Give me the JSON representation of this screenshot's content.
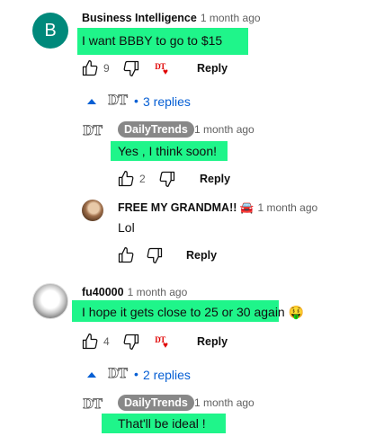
{
  "comments": [
    {
      "avatar_letter": "B",
      "author": "Business Intelligence",
      "time": "1 month ago",
      "text": "I want BBBY to go to $15",
      "likes": "9",
      "reply_label": "Reply",
      "replies_label": "3 replies",
      "replies": [
        {
          "author": "DailyTrends",
          "time": "1 month ago",
          "text": "Yes , I think soon!",
          "likes": "2",
          "reply_label": "Reply"
        },
        {
          "author": "FREE MY GRANDMA!!",
          "time": "1 month ago",
          "text": "Lol",
          "likes": "",
          "reply_label": "Reply"
        }
      ]
    },
    {
      "author": "fu40000",
      "time": "1 month ago",
      "text": "I hope it gets close to 25 or 30 again",
      "emoji": "🤑",
      "likes": "4",
      "reply_label": "Reply",
      "replies_label": "2 replies",
      "replies": [
        {
          "author": "DailyTrends",
          "time": "1 month ago",
          "text": "That'll be ideal !"
        }
      ]
    }
  ],
  "logo_text": "DT",
  "car_emoji": "🚘",
  "colors": {
    "highlight": "#1ff58a",
    "link": "#065fd4",
    "avatar_b": "#00897b",
    "logo_red": "#e00000"
  }
}
